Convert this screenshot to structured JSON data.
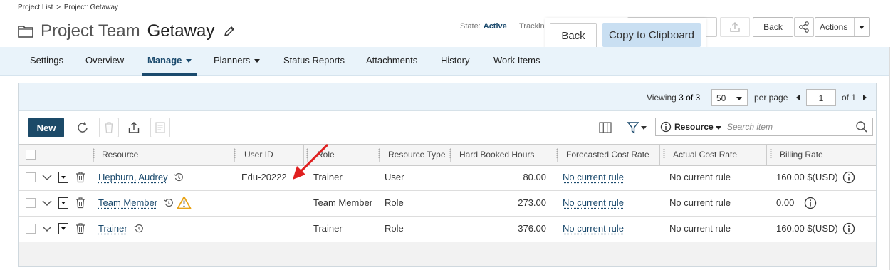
{
  "breadcrumb": {
    "parent": "Project List",
    "sep": ">",
    "current": "Project: Getaway"
  },
  "header": {
    "title_prefix": "Project Team",
    "title_name": "Getaway",
    "state_label": "State:",
    "state_value": "Active",
    "tracking_label": "Trackin",
    "back_label": "Back",
    "actions_label": "Actions"
  },
  "popup": {
    "back_label": "Back",
    "copy_label": "Copy to Clipboard"
  },
  "nav": {
    "tabs": [
      {
        "label": "Settings"
      },
      {
        "label": "Overview"
      },
      {
        "label": "Manage"
      },
      {
        "label": "Planners"
      },
      {
        "label": "Status Reports"
      },
      {
        "label": "Attachments"
      },
      {
        "label": "History"
      },
      {
        "label": "Work Items"
      }
    ],
    "active": "Manage"
  },
  "pager": {
    "viewing_label": "Viewing",
    "viewing_range": "3 of 3",
    "per_page_value": "50",
    "per_page_label": "per page",
    "page_value": "1",
    "of_label": "of 1"
  },
  "toolbar": {
    "new_label": "New",
    "search_field_label": "Resource",
    "search_placeholder": "Search item"
  },
  "columns": [
    "Resource",
    "User ID",
    "Role",
    "Resource Type",
    "Hard Booked Hours",
    "Forecasted Cost Rate",
    "Actual Cost Rate",
    "Billing Rate"
  ],
  "rows": [
    {
      "resource": "Hepburn, Audrey",
      "user_id": "Edu-20222",
      "role": "Trainer",
      "type": "User",
      "hours": "80.00",
      "forecast": "No current rule",
      "actual": "No current rule",
      "billing": "160.00 $(USD)",
      "warning": false
    },
    {
      "resource": "Team Member",
      "user_id": "",
      "role": "Team Member",
      "type": "Role",
      "hours": "273.00",
      "forecast": "No current rule",
      "actual": "No current rule",
      "billing": "0.00",
      "warning": true
    },
    {
      "resource": "Trainer",
      "user_id": "",
      "role": "Trainer",
      "type": "Role",
      "hours": "376.00",
      "forecast": "No current rule",
      "actual": "No current rule",
      "billing": "160.00 $(USD)",
      "warning": false
    }
  ],
  "colors": {
    "primary": "#1c4a68",
    "nav_bg": "#e9f3fa",
    "popup_highlight": "#c9dff2",
    "annotation": "#e02020",
    "warning": "#e8a317"
  }
}
